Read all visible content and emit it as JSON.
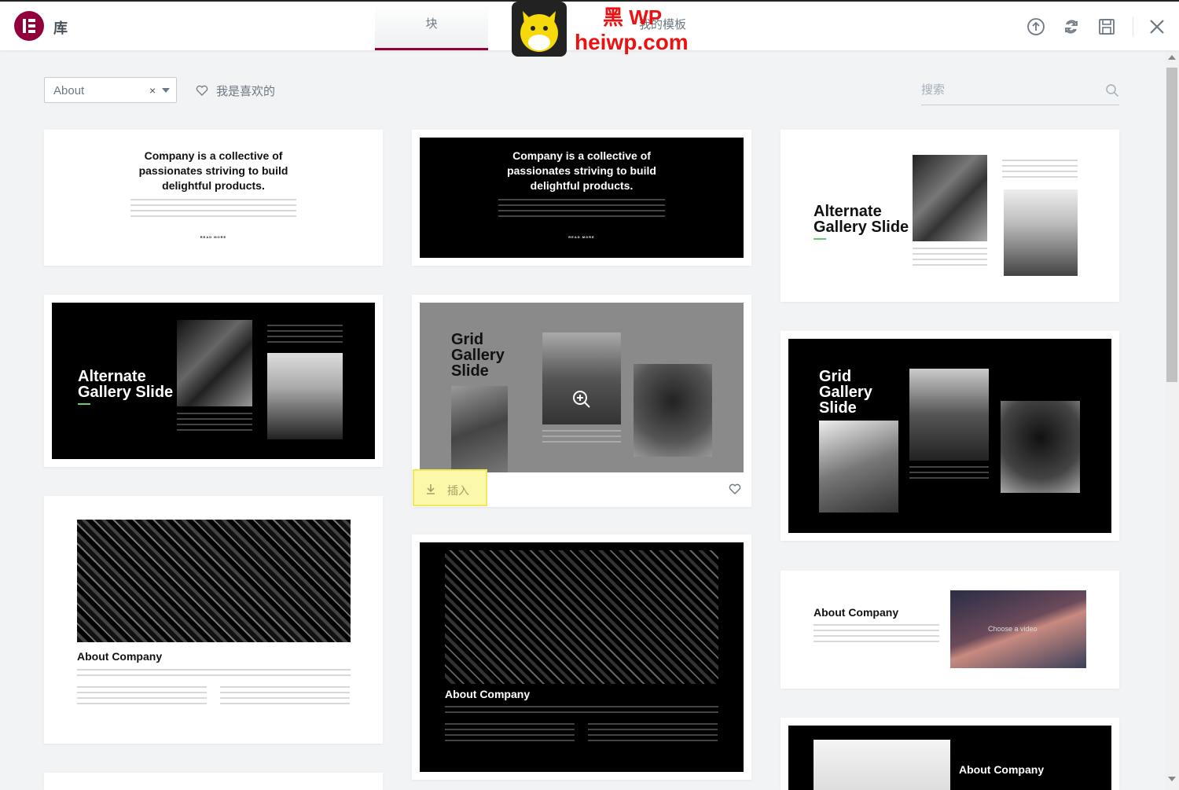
{
  "header": {
    "title": "库",
    "tabs": [
      {
        "label": "块",
        "active": true
      },
      {
        "label": "我的模板",
        "active": false
      }
    ],
    "watermark": {
      "line1": "黑 WP",
      "line2": "heiwp.com"
    },
    "icons": [
      "upload-icon",
      "sync-icon",
      "save-icon",
      "close-icon"
    ]
  },
  "toolbar": {
    "filter_value": "About",
    "clear_symbol": "×",
    "favorites_label": "我是喜欢的",
    "search_placeholder": "搜索"
  },
  "cards": {
    "c1": {
      "title": "Company is a collective of passionates striving to build delightful products.",
      "link": "READ MORE"
    },
    "c2": {
      "title": "Company is a collective of passionates striving to build delightful products.",
      "link": "READ MORE"
    },
    "c3": {
      "title": "Alternate Gallery Slide"
    },
    "c4": {
      "title": "Alternate Gallery Slide"
    },
    "c5": {
      "title": "Grid Gallery Slide"
    },
    "c6": {
      "title": "Grid Gallery Slide"
    },
    "c7": {
      "title": "About Company"
    },
    "c8": {
      "title": "About Company"
    },
    "c9": {
      "title": "About Company",
      "video_caption": "Choose a video"
    },
    "c10": {
      "title": "About Company"
    }
  },
  "hover": {
    "insert_label": "插入"
  },
  "colors": {
    "brand": "#92003b",
    "accent_green": "#61ce70",
    "insert_bg": "#fbf9a9"
  }
}
